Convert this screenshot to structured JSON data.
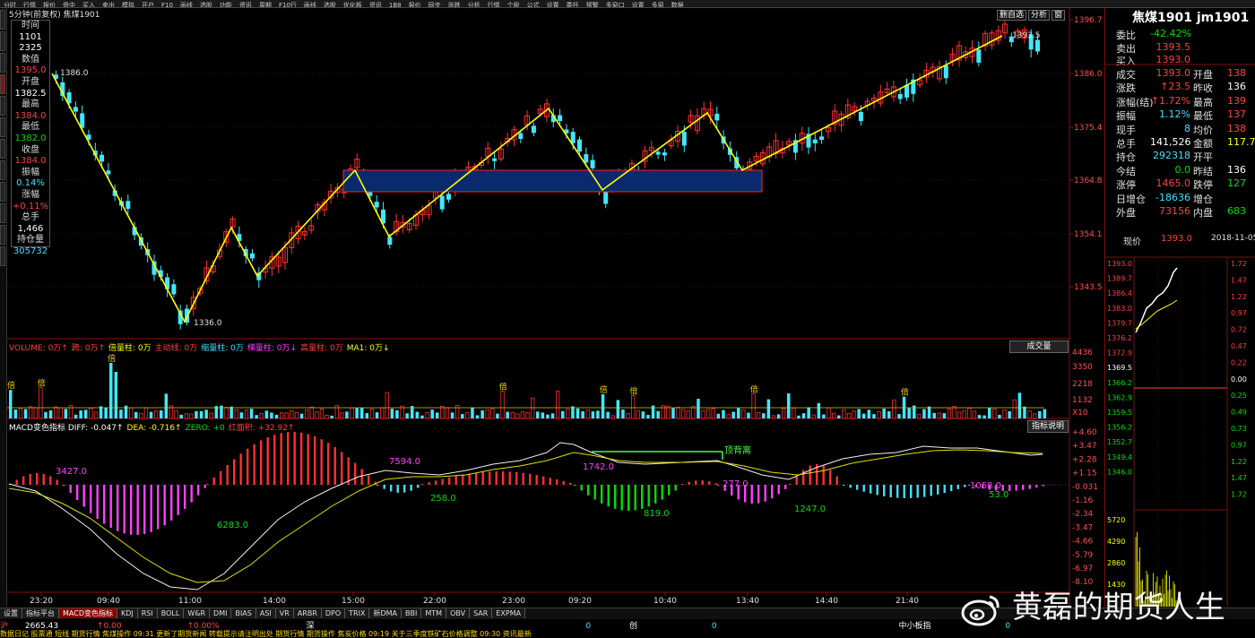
{
  "topbar": {
    "items": [
      "分时",
      "行情",
      "报价",
      "盘中",
      "买入",
      "卖出",
      "模拟",
      "开户",
      "F10",
      "画线",
      "选股",
      "功能",
      "资讯",
      "周期",
      "F10行",
      "画线",
      "选股",
      "优化板",
      "资讯",
      "1B8",
      "报价",
      "同步",
      "涨跌",
      "分析",
      "行情",
      "个股",
      "公式",
      "设置",
      "委托",
      "预警",
      "多窗口",
      "设置",
      "多窗",
      "数据"
    ]
  },
  "chart": {
    "title": "5分钟(前复权)  焦煤1901",
    "controls": [
      "删自选",
      "分析",
      "窗"
    ],
    "price_axis": [
      "1396.7",
      "1386.0",
      "1375.4",
      "1364.8",
      "1354.1",
      "1343.5"
    ],
    "annotations": {
      "high_label": "1386.0",
      "low_label": "1336.0",
      "last_label": "1393.5"
    },
    "colors": {
      "up": "#ff3030",
      "down": "#40e8ff",
      "zigzag": "#ffff00",
      "box_fill": "#0b2a6e",
      "box_border": "#ff2020"
    }
  },
  "infobox": [
    {
      "t": "时间",
      "c": "lbl"
    },
    {
      "t": "1101",
      "c": "white"
    },
    {
      "t": "2325",
      "c": "white"
    },
    {
      "t": "数值",
      "c": "lbl"
    },
    {
      "t": "1395.0",
      "c": "red"
    },
    {
      "t": "开盘",
      "c": "lbl"
    },
    {
      "t": "1382.5",
      "c": "white"
    },
    {
      "t": "最高",
      "c": "lbl"
    },
    {
      "t": "1384.0",
      "c": "red"
    },
    {
      "t": "最低",
      "c": "lbl"
    },
    {
      "t": "1382.0",
      "c": "green"
    },
    {
      "t": "收盘",
      "c": "lbl"
    },
    {
      "t": "1384.0",
      "c": "red"
    },
    {
      "t": "振幅",
      "c": "lbl"
    },
    {
      "t": "0.14%",
      "c": "cyan"
    },
    {
      "t": "涨幅",
      "c": "lbl"
    },
    {
      "t": "+0.11%",
      "c": "red"
    },
    {
      "t": "总手",
      "c": "lbl"
    },
    {
      "t": "1,466",
      "c": "white"
    },
    {
      "t": "持仓量",
      "c": "lbl"
    },
    {
      "t": "305732",
      "c": "cyan"
    }
  ],
  "volume": {
    "legend": [
      {
        "t": "VOLUME: 0万↑",
        "c": "red"
      },
      {
        "t": "跨: 0万↑",
        "c": "red"
      },
      {
        "t": "倍量柱: 0万",
        "c": "yellow"
      },
      {
        "t": "主动线: 0万",
        "c": "red"
      },
      {
        "t": "缩量柱: 0万",
        "c": "cyan"
      },
      {
        "t": "梯量柱: 0万↓",
        "c": "magenta"
      },
      {
        "t": "高量柱: 0万",
        "c": "red"
      },
      {
        "t": "MA1: 0万↓",
        "c": "yellow"
      }
    ],
    "button": "成交量",
    "axis": [
      "4436",
      "3350",
      "2218",
      "1132",
      "X10"
    ],
    "marker": "倍"
  },
  "macd": {
    "legend": [
      {
        "t": "MACD变色指标 DIFF: -0.047↑",
        "c": "white"
      },
      {
        "t": "DEA: -0.716↑",
        "c": "yellow"
      },
      {
        "t": "ZERO: +0",
        "c": "green"
      },
      {
        "t": "红面积: +32.92↑",
        "c": "red"
      }
    ],
    "button": "指标说明",
    "axis": [
      "+4.60",
      "+3.47",
      "+2.28",
      "+1.15",
      "-0.031",
      "-1.16",
      "-2.34",
      "-3.47",
      "-4.66",
      "-5.79",
      "-6.97",
      "-8.10"
    ],
    "areas": [
      {
        "t": "3427.0",
        "c": "magenta"
      },
      {
        "t": "6283.0",
        "c": "green"
      },
      {
        "t": "7594.0",
        "c": "magenta"
      },
      {
        "t": "258.0",
        "c": "green"
      },
      {
        "t": "1742.0",
        "c": "magenta"
      },
      {
        "t": "819.0",
        "c": "green"
      },
      {
        "t": "277.0",
        "c": "magenta"
      },
      {
        "t": "1247.0",
        "c": "green"
      },
      {
        "t": "1058.0",
        "c": "magenta"
      },
      {
        "t": "53.0",
        "c": "green"
      }
    ],
    "divergence_label": "顶背离"
  },
  "time_axis": [
    "23:20",
    "09:40",
    "11:00",
    "14:00",
    "15:00",
    "22:00",
    "23:00",
    "09:20",
    "10:40",
    "13:40",
    "14:40",
    "21:40"
  ],
  "right_panel": {
    "title": "焦煤1901 jm1901",
    "rows": [
      {
        "l": "委比",
        "v": "-42.42%",
        "vc": "green"
      },
      {
        "l": "卖出",
        "v": "1393.5",
        "vc": "red"
      },
      {
        "l": "买入",
        "v": "1393.0",
        "vc": "red"
      }
    ],
    "grid": [
      {
        "l": "成交",
        "v": "1393.0",
        "vc": "red",
        "l2": "开盘",
        "v2": "138",
        "v2c": "red"
      },
      {
        "l": "涨跌",
        "v": "↑23.5",
        "vc": "red",
        "l2": "昨收",
        "v2": "136",
        "v2c": "white"
      },
      {
        "l": "涨幅(结)",
        "v": "↑1.72%",
        "vc": "red",
        "l2": "最高",
        "v2": "139",
        "v2c": "red"
      },
      {
        "l": "振幅",
        "v": "1.12%",
        "vc": "cyan",
        "l2": "最低",
        "v2": "137",
        "v2c": "red"
      },
      {
        "l": "现手",
        "v": "8",
        "vc": "cyan",
        "l2": "均价",
        "v2": "138",
        "v2c": "red"
      },
      {
        "l": "总手",
        "v": "141,526",
        "vc": "white",
        "l2": "金额",
        "v2": "117.7",
        "v2c": "yellow"
      },
      {
        "l": "持仓",
        "v": "292318",
        "vc": "cyan",
        "l2": "开平",
        "v2": "",
        "v2c": "white"
      },
      {
        "l": "今结",
        "v": "0.0",
        "vc": "green",
        "l2": "昨结",
        "v2": "136",
        "v2c": "white"
      },
      {
        "l": "涨停",
        "v": "1465.0",
        "vc": "red",
        "l2": "跌停",
        "v2": "127",
        "v2c": "green"
      },
      {
        "l": "日增仓",
        "v": "-18636",
        "vc": "cyan",
        "l2": "增仓",
        "v2": "",
        "v2c": "white"
      },
      {
        "l": "外盘",
        "v": "73156",
        "vc": "red",
        "l2": "内盘",
        "v2": "683",
        "v2c": "green"
      }
    ],
    "now": {
      "l": "现价",
      "v": "1393.0",
      "d": "2018-11-05"
    },
    "mini_axis": [
      "1393.0",
      "1389.7",
      "1386.4",
      "1383.0",
      "1379.7",
      "1376.2",
      "1372.9",
      "1369.5",
      "1366.2",
      "1362.9",
      "1359.5",
      "1356.2",
      "1352.7",
      "1349.4",
      "1346.0",
      "5720",
      "4290",
      "2860",
      "1430"
    ],
    "mini_pct": [
      "1.72",
      "1.47",
      "1.22",
      "0.97",
      "0.72",
      "0.47",
      "0.22",
      "0.00",
      "0.25",
      "0.49",
      "0.73",
      "0.97",
      "1.22",
      "1.47",
      "1.72"
    ]
  },
  "tabs": [
    "设置",
    "指标平台",
    "MACD变色指标",
    "KDJ",
    "RSI",
    "BOLL",
    "W&R",
    "DMI",
    "BIAS",
    "ASI",
    "VR",
    "ARBR",
    "DPO",
    "TRIX",
    "新DMA",
    "BBI",
    "MTM",
    "OBV",
    "SAR",
    "EXPMA"
  ],
  "status": {
    "index_label": "沪",
    "index_value": "2665.43",
    "chg": "↑0.00",
    "pct": "↑0.00%",
    "sz_label": "深",
    "sz_value": "0",
    "cy_label": "创",
    "cy_value": "0",
    "zx_label": "中小板指",
    "zx_value": "0"
  },
  "ticker": "数据日记  股票通  短线  期货行情  焦煤操作  09:31 更新了期货新闻  转载提示请注明出处  期货行情  期货操作  焦炭价格  09:19 关于三季度铁矿石价格调整  09:30 资讯最新",
  "watermark": "黄磊的期货人生"
}
